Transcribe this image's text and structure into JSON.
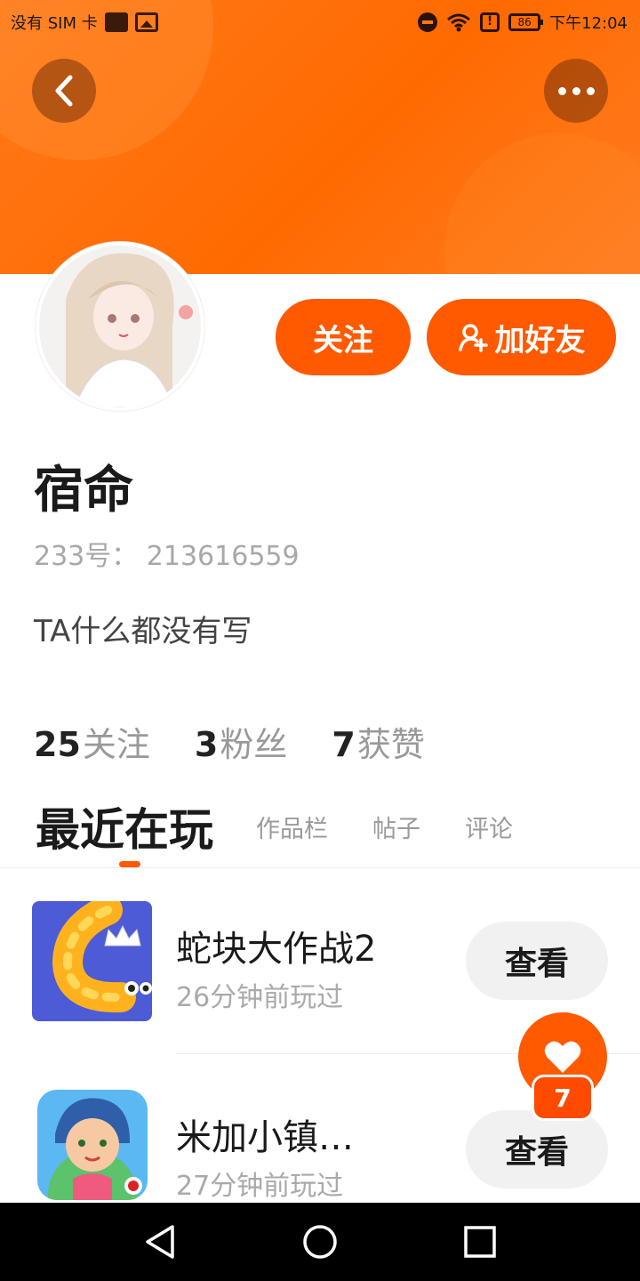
{
  "status_bar": {
    "carrier": "没有 SIM 卡",
    "battery": "86",
    "time": "下午12:04",
    "icons": [
      "notification-square-icon",
      "image-icon",
      "dnd-icon",
      "wifi-icon",
      "alert-icon",
      "battery-icon"
    ]
  },
  "header": {
    "back_icon": "chevron-left-icon",
    "more_icon": "more-dots-icon",
    "accent_color": "#ff6a00"
  },
  "profile": {
    "name": "宿命",
    "uid": "233号： 213616559",
    "bio": "TA什么都没有写",
    "follow_label": "关注",
    "add_friend_label": "加好友"
  },
  "stats": [
    {
      "value": "25",
      "label": "关注"
    },
    {
      "value": "3",
      "label": "粉丝"
    },
    {
      "value": "7",
      "label": "获赞"
    }
  ],
  "tabs": [
    {
      "label": "最近在玩",
      "active": true
    },
    {
      "label": "作品栏",
      "active": false
    },
    {
      "label": "帖子",
      "active": false
    },
    {
      "label": "评论",
      "active": false
    }
  ],
  "games": [
    {
      "name": "蛇块大作战2",
      "time": "26分钟前玩过",
      "action": "查看",
      "icon": "snake-game-icon"
    },
    {
      "name": "米加小镇…",
      "time": "27分钟前玩过",
      "action": "查看",
      "icon": "miga-town-icon"
    }
  ],
  "fab": {
    "icon": "heart-icon",
    "count": "7"
  },
  "nav": {
    "icons": [
      "back-triangle-icon",
      "home-circle-icon",
      "recents-square-icon"
    ]
  }
}
